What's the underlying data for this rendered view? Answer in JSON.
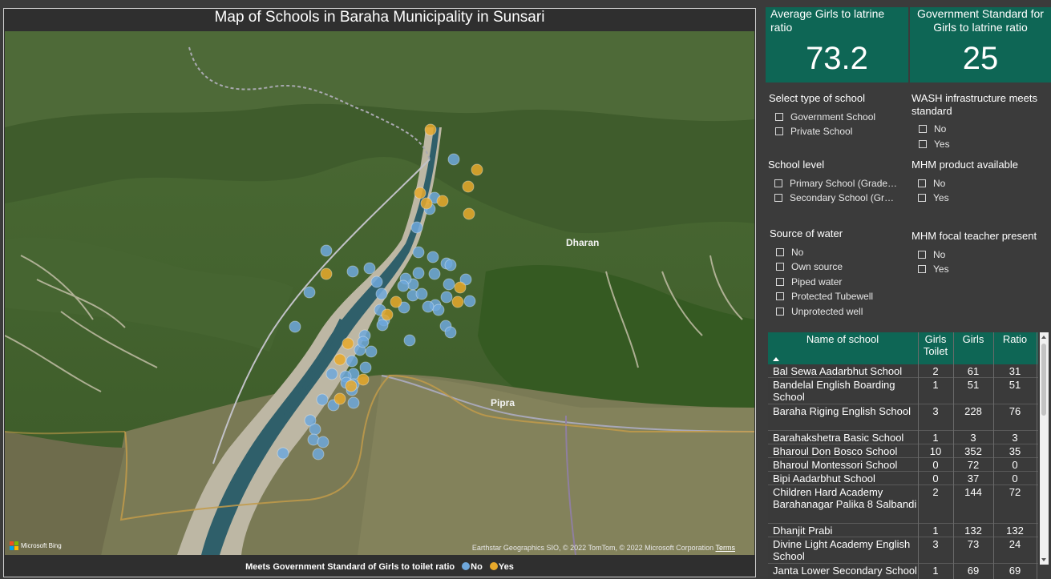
{
  "map": {
    "title": "Map of Schools in Baraha Municipality in Sunsari",
    "place_labels": [
      "Dharan",
      "Pipra"
    ],
    "attribution": "Earthstar Geographics SIO, © 2022 TomTom, © 2022 Microsoft Corporation",
    "terms": "Terms",
    "bing": "Microsoft Bing",
    "legend": {
      "title": "Meets Government Standard of Girls to toilet ratio",
      "no": "No",
      "yes": "Yes"
    },
    "colors": {
      "no": "#6fa8dc",
      "yes": "#e8a92b"
    },
    "points_no": [
      [
        565,
        198
      ],
      [
        541,
        246
      ],
      [
        535,
        260
      ],
      [
        519,
        283
      ],
      [
        406,
        312
      ],
      [
        521,
        314
      ],
      [
        539,
        320
      ],
      [
        556,
        328
      ],
      [
        561,
        330
      ],
      [
        460,
        334
      ],
      [
        439,
        338
      ],
      [
        521,
        340
      ],
      [
        541,
        341
      ],
      [
        469,
        351
      ],
      [
        559,
        354
      ],
      [
        580,
        348
      ],
      [
        514,
        354
      ],
      [
        505,
        347
      ],
      [
        385,
        364
      ],
      [
        502,
        356
      ],
      [
        475,
        366
      ],
      [
        514,
        368
      ],
      [
        525,
        366
      ],
      [
        556,
        370
      ],
      [
        542,
        380
      ],
      [
        585,
        375
      ],
      [
        533,
        382
      ],
      [
        546,
        386
      ],
      [
        503,
        383
      ],
      [
        473,
        386
      ],
      [
        478,
        399
      ],
      [
        476,
        405
      ],
      [
        555,
        406
      ],
      [
        561,
        414
      ],
      [
        367,
        407
      ],
      [
        510,
        424
      ],
      [
        454,
        418
      ],
      [
        448,
        436
      ],
      [
        462,
        438
      ],
      [
        452,
        426
      ],
      [
        438,
        450
      ],
      [
        455,
        458
      ],
      [
        440,
        466
      ],
      [
        413,
        466
      ],
      [
        430,
        469
      ],
      [
        431,
        477
      ],
      [
        440,
        479
      ],
      [
        438,
        486
      ],
      [
        401,
        498
      ],
      [
        415,
        505
      ],
      [
        440,
        502
      ],
      [
        386,
        524
      ],
      [
        392,
        535
      ],
      [
        390,
        548
      ],
      [
        402,
        551
      ],
      [
        396,
        566
      ],
      [
        352,
        565
      ]
    ],
    "points_yes": [
      [
        536,
        161
      ],
      [
        594,
        211
      ],
      [
        583,
        232
      ],
      [
        523,
        240
      ],
      [
        531,
        253
      ],
      [
        551,
        250
      ],
      [
        584,
        266
      ],
      [
        406,
        341
      ],
      [
        573,
        358
      ],
      [
        570,
        376
      ],
      [
        493,
        376
      ],
      [
        482,
        392
      ],
      [
        433,
        428
      ],
      [
        423,
        448
      ],
      [
        452,
        473
      ],
      [
        437,
        481
      ],
      [
        423,
        497
      ]
    ]
  },
  "cards": [
    {
      "label": "Average Girls to latrine ratio",
      "value": "73.2"
    },
    {
      "label": "Government Standard for Girls to latrine ratio",
      "value": "25"
    }
  ],
  "filters": {
    "type_of_school": {
      "title": "Select type of school",
      "options": [
        "Government School",
        "Private School"
      ]
    },
    "wash": {
      "title": "WASH infrastructure meets standard",
      "options": [
        "No",
        "Yes"
      ]
    },
    "school_level": {
      "title": "School level",
      "options": [
        "Primary School (Grade…",
        "Secondary School (Gr…"
      ]
    },
    "mhm_product": {
      "title": "MHM product available",
      "options": [
        "No",
        "Yes"
      ]
    },
    "water": {
      "title": "Source of water",
      "options": [
        "No",
        "Own source",
        "Piped water",
        "Protected Tubewell",
        "Unprotected well"
      ]
    },
    "mhm_teacher": {
      "title": "MHM focal teacher present",
      "options": [
        "No",
        "Yes"
      ]
    }
  },
  "table": {
    "headers": {
      "name": "Name of school",
      "toilet": "Girls Toilet",
      "girls": "Girls",
      "ratio": "Ratio"
    },
    "rows": [
      [
        "Bal Sewa Aadarbhut School",
        "2",
        "61",
        "31"
      ],
      [
        "Bandelal English Boarding School",
        "1",
        "51",
        "51"
      ],
      [
        "Baraha Riging English School",
        "3",
        "228",
        "76"
      ],
      [
        "Barahakshetra Basic School",
        "1",
        "3",
        "3"
      ],
      [
        "Bharoul Don Bosco School",
        "10",
        "352",
        "35"
      ],
      [
        "Bharoul Montessori School",
        "0",
        "72",
        "0"
      ],
      [
        "Bipi Aadarbhut School",
        "0",
        "37",
        "0"
      ],
      [
        "Children Hard Academy Barahanagar Palika 8 Salbandi",
        "2",
        "144",
        "72"
      ],
      [
        "Dhanjit Prabi",
        "1",
        "132",
        "132"
      ],
      [
        "Divine Light Academy English School",
        "3",
        "73",
        "24"
      ],
      [
        "Janta Lower Secondary School",
        "1",
        "69",
        "69"
      ]
    ]
  }
}
